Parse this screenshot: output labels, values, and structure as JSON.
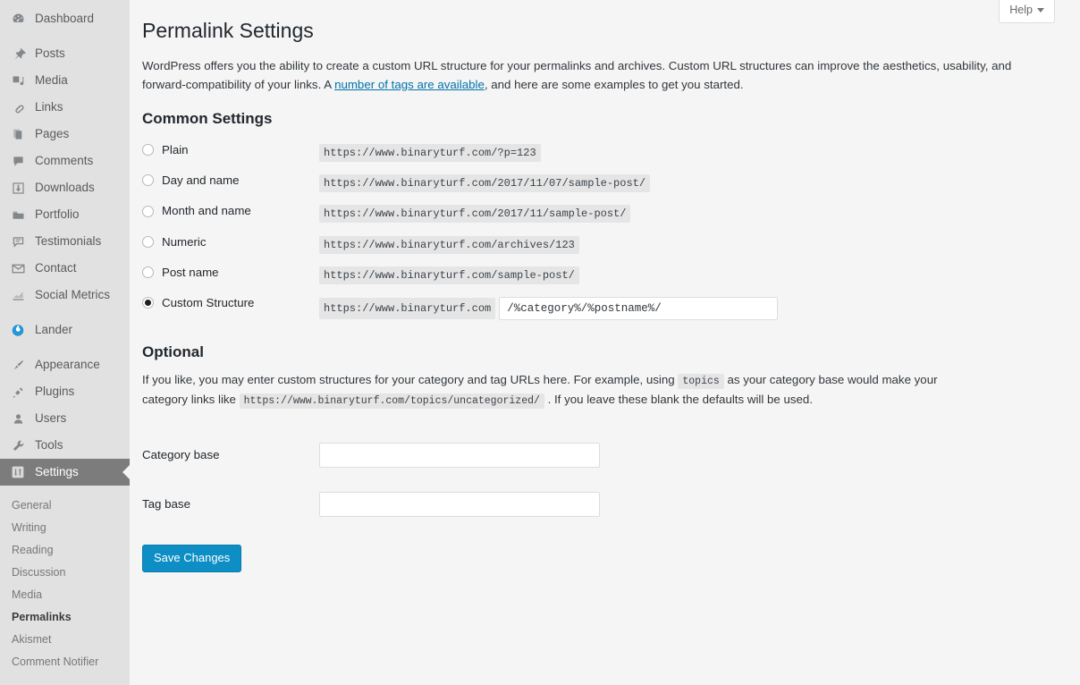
{
  "sidebar": {
    "items": [
      {
        "label": "Dashboard",
        "icon": "dashboard-icon"
      },
      {
        "label": "Posts",
        "icon": "pin-icon"
      },
      {
        "label": "Media",
        "icon": "media-icon"
      },
      {
        "label": "Links",
        "icon": "link-icon"
      },
      {
        "label": "Pages",
        "icon": "pages-icon"
      },
      {
        "label": "Comments",
        "icon": "comment-icon"
      },
      {
        "label": "Downloads",
        "icon": "download-icon"
      },
      {
        "label": "Portfolio",
        "icon": "folder-icon"
      },
      {
        "label": "Testimonials",
        "icon": "testimonial-icon"
      },
      {
        "label": "Contact",
        "icon": "envelope-icon"
      },
      {
        "label": "Social Metrics",
        "icon": "chart-icon"
      },
      {
        "label": "Lander",
        "icon": "lander-icon"
      },
      {
        "label": "Appearance",
        "icon": "brush-icon"
      },
      {
        "label": "Plugins",
        "icon": "plug-icon"
      },
      {
        "label": "Users",
        "icon": "user-icon"
      },
      {
        "label": "Tools",
        "icon": "wrench-icon"
      },
      {
        "label": "Settings",
        "icon": "settings-icon"
      }
    ],
    "active_item": "Settings",
    "submenu": [
      {
        "label": "General",
        "current": false
      },
      {
        "label": "Writing",
        "current": false
      },
      {
        "label": "Reading",
        "current": false
      },
      {
        "label": "Discussion",
        "current": false
      },
      {
        "label": "Media",
        "current": false
      },
      {
        "label": "Permalinks",
        "current": true
      },
      {
        "label": "Akismet",
        "current": false
      },
      {
        "label": "Comment Notifier",
        "current": false
      }
    ]
  },
  "header": {
    "help_label": "Help",
    "page_title": "Permalink Settings"
  },
  "intro": {
    "part1": "WordPress offers you the ability to create a custom URL structure for your permalinks and archives. Custom URL structures can improve the aesthetics, usability, and forward-compatibility of your links. A ",
    "link_text": "number of tags are available",
    "part2": ", and here are some examples to get you started."
  },
  "common_settings": {
    "heading": "Common Settings",
    "options": [
      {
        "label": "Plain",
        "example": "https://www.binaryturf.com/?p=123",
        "selected": false
      },
      {
        "label": "Day and name",
        "example": "https://www.binaryturf.com/2017/11/07/sample-post/",
        "selected": false
      },
      {
        "label": "Month and name",
        "example": "https://www.binaryturf.com/2017/11/sample-post/",
        "selected": false
      },
      {
        "label": "Numeric",
        "example": "https://www.binaryturf.com/archives/123",
        "selected": false
      },
      {
        "label": "Post name",
        "example": "https://www.binaryturf.com/sample-post/",
        "selected": false
      }
    ],
    "custom": {
      "label": "Custom Structure",
      "selected": true,
      "prefix": "https://www.binaryturf.com",
      "value": "/%category%/%postname%/",
      "placeholder": ""
    }
  },
  "optional": {
    "heading": "Optional",
    "text_part1": "If you like, you may enter custom structures for your category and tag URLs here. For example, using ",
    "code_topics": "topics",
    "text_part2": " as your category base would make your category links like ",
    "code_url": "https://www.binaryturf.com/topics/uncategorized/",
    "text_part3": " . If you leave these blank the defaults will be used.",
    "category_base_label": "Category base",
    "category_base_value": "",
    "tag_base_label": "Tag base",
    "tag_base_value": ""
  },
  "actions": {
    "save_label": "Save Changes"
  },
  "colors": {
    "accent": "#0d8ec4",
    "link": "#0073aa",
    "sidebar_bg": "#e1e1e1",
    "active_bg": "#7c7c7c",
    "content_bg": "#f5f5f5",
    "code_bg": "#e5e5e5"
  }
}
